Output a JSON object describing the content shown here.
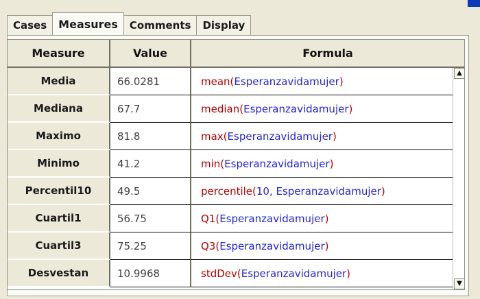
{
  "tabs": [
    {
      "label": "Cases"
    },
    {
      "label": "Measures"
    },
    {
      "label": "Comments"
    },
    {
      "label": "Display"
    }
  ],
  "table": {
    "headers": [
      "Measure",
      "Value",
      "Formula"
    ],
    "rows": [
      {
        "measure": "Media",
        "value": "66.0281",
        "fn": "mean",
        "args": "Esperanzavidamujer"
      },
      {
        "measure": "Mediana",
        "value": "67.7",
        "fn": "median",
        "args": "Esperanzavidamujer"
      },
      {
        "measure": "Maximo",
        "value": "81.8",
        "fn": "max",
        "args": "Esperanzavidamujer"
      },
      {
        "measure": "Minimo",
        "value": "41.2",
        "fn": "min",
        "args": "Esperanzavidamujer"
      },
      {
        "measure": "Percentil10",
        "value": "49.5",
        "fn": "percentile",
        "args": "10, Esperanzavidamujer"
      },
      {
        "measure": "Cuartil1",
        "value": "56.75",
        "fn": "Q1",
        "args": "Esperanzavidamujer"
      },
      {
        "measure": "Cuartil3",
        "value": "75.25",
        "fn": "Q3",
        "args": "Esperanzavidamujer"
      },
      {
        "measure": "Desvestan",
        "value": "10.9968",
        "fn": "stdDev",
        "args": "Esperanzavidamujer"
      }
    ]
  },
  "colors": {
    "formula_fn": "#b30000",
    "formula_arg": "#2424d8"
  },
  "icons": {
    "scroll_up": "scroll-up-arrow-icon",
    "scroll_down": "scroll-down-arrow-icon"
  }
}
